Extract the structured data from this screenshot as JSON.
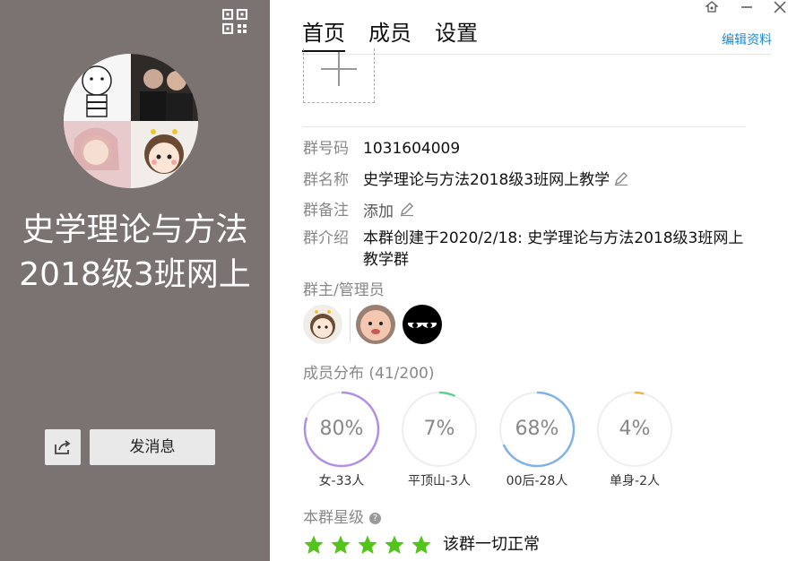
{
  "group": {
    "title_line1": "史学理论与方法",
    "title_line2": "2018级3班网上",
    "send_message_label": "发消息"
  },
  "tabs": [
    {
      "label": "首页",
      "active": true
    },
    {
      "label": "成员",
      "active": false
    },
    {
      "label": "设置",
      "active": false
    }
  ],
  "edit_profile_label": "编辑资料",
  "info": {
    "number_label": "群号码",
    "number_value": "1031604009",
    "name_label": "群名称",
    "name_value": "史学理论与方法2018级3班网上教学",
    "remark_label": "群备注",
    "remark_value": "添加",
    "intro_label": "群介绍",
    "intro_value": "本群创建于2020/2/18:  史学理论与方法2018级3班网上教学群"
  },
  "admins_label": "群主/管理员",
  "distribution": {
    "label": "成员分布",
    "count": "(41/200)",
    "items": [
      {
        "percent": "80%",
        "fraction": 0.8,
        "caption": "女-33人",
        "color": "#b38ee6"
      },
      {
        "percent": "7%",
        "fraction": 0.07,
        "caption": "平顶山-3人",
        "color": "#5fd08a"
      },
      {
        "percent": "68%",
        "fraction": 0.68,
        "caption": "00后-28人",
        "color": "#7fb2ea"
      },
      {
        "percent": "4%",
        "fraction": 0.04,
        "caption": "单身-2人",
        "color": "#f2b447"
      }
    ]
  },
  "rating": {
    "label": "本群星级",
    "stars": 5,
    "max_stars": 5,
    "status": "该群一切正常",
    "star_color": "#52c41a"
  },
  "icons": [
    "qr-code-icon",
    "share-icon",
    "pin-icon",
    "minimize-icon",
    "close-icon",
    "pencil-icon",
    "help-icon",
    "plus-icon",
    "star-icon"
  ]
}
